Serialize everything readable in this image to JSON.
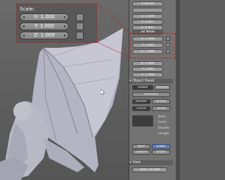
{
  "scale_zoom": {
    "title": "Scale:",
    "x": "X: 1.000",
    "y": "Y: 1.000",
    "z": "Z: 1.000"
  },
  "panel": {
    "top_values": [
      "2.24704",
      "",
      "X: 1.000",
      "Y: 0.927",
      "Z: 0.927",
      "3D Mode"
    ],
    "scale_values": [
      "X: 1.000",
      "Y: 1.000",
      "Z: 1.000"
    ],
    "dim_values": [
      "X: 1.000",
      "Y: 1.000",
      "Z: 1.000"
    ],
    "object_panel_label": "Object Panel",
    "rows": [
      "Global",
      "Newpos",
      "Selection",
      "Render",
      "Global",
      "Curve",
      "Show"
    ],
    "draw_buttons": [
      "Wire",
      "Color",
      "Outline",
      "Shade"
    ],
    "checkbox_labels": [
      "Back",
      "Front",
      "Double",
      "Length"
    ],
    "view_label": "View",
    "view_value": "Lens: 35.000"
  },
  "colors": {
    "highlight": "#c02020",
    "accent_blue": "#5a82c8"
  }
}
